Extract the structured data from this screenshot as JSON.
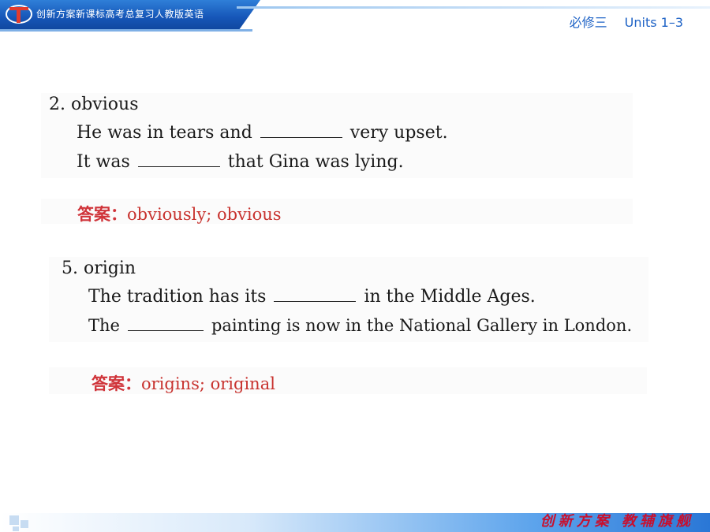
{
  "header": {
    "title": "创新方案新课标高考总复习人教版英语",
    "book": "必修三",
    "units": "Units 1–3"
  },
  "items": [
    {
      "head": "2. obvious",
      "s1_before": "He was in tears and",
      "s1_after": "very upset.",
      "s2_before": "It was",
      "s2_after": "that Gina was lying.",
      "answer_label": "答案：",
      "answer": "obviously; obvious"
    },
    {
      "head": "5. origin",
      "s1_before": "The tradition has its",
      "s1_after": "in the Middle Ages.",
      "s2_before": "The",
      "s2_after": "painting is now in the National Gallery in London.",
      "answer_label": "答案：",
      "answer": "origins; original"
    }
  ],
  "footer": {
    "slogan": "创新方案 教辅旗舰"
  },
  "colors": {
    "header_blue": "#1656b8",
    "accent_red": "#c8332f",
    "header_text_blue": "#1f63c6"
  }
}
